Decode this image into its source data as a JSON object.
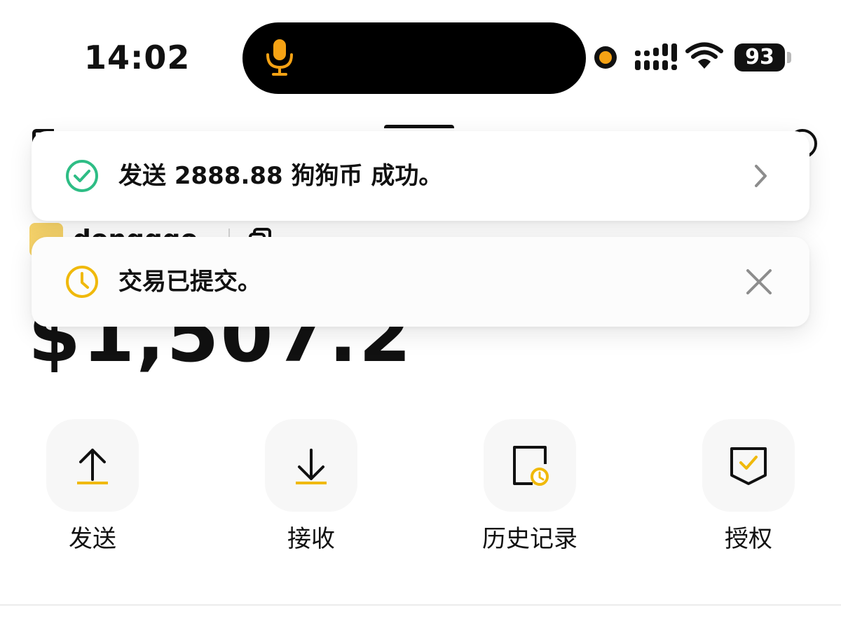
{
  "status_bar": {
    "time": "14:02",
    "battery": "93"
  },
  "wallet": {
    "account_name": "dongqqo",
    "balance": "$1,507.2"
  },
  "toasts": [
    {
      "message": "发送 2888.88 狗狗币 成功。",
      "status": "success",
      "icon": "check-circle-icon"
    },
    {
      "message": "交易已提交。",
      "status": "pending",
      "icon": "clock-icon"
    }
  ],
  "actions": [
    {
      "label": "发送",
      "icon": "arrow-up-icon"
    },
    {
      "label": "接收",
      "icon": "arrow-down-icon"
    },
    {
      "label": "历史记录",
      "icon": "history-icon"
    },
    {
      "label": "授权",
      "icon": "shield-check-icon"
    }
  ],
  "colors": {
    "accent": "#F0B90B",
    "success": "#2EBD85",
    "mic": "#F5A214"
  }
}
